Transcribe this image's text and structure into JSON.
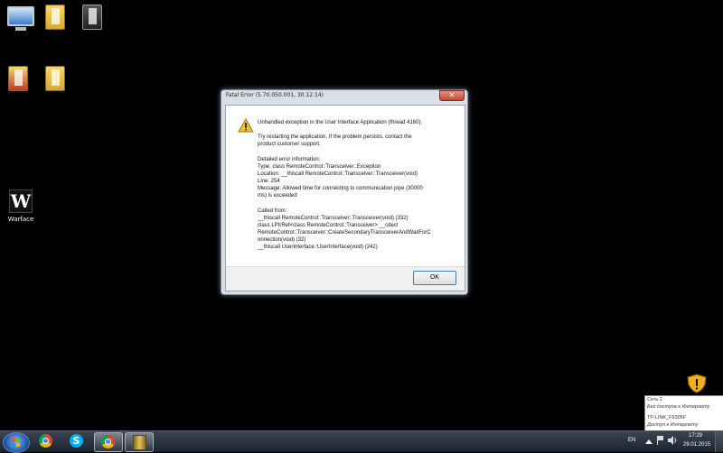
{
  "desktop": {
    "icons": [
      {
        "name": "computer-icon",
        "label": ""
      },
      {
        "name": "folder-icon",
        "label": ""
      },
      {
        "name": "folder-icon",
        "label": ""
      },
      {
        "name": "folder-icon",
        "label": ""
      },
      {
        "name": "folder-icon",
        "label": ""
      },
      {
        "name": "warface-icon",
        "label": "Warface"
      }
    ]
  },
  "dialog": {
    "title": "Fatal Error (5.70.050.001, 30.12.14)",
    "close_glyph": "✕",
    "lines": [
      "Unhandled exception in the User Interface Application (thread 4160).",
      "Try restarting the application. If the problem persists, contact the",
      "product customer support.",
      "Detailed error information:",
      "Type: class RemoteControl::Transceiver::Exception",
      "Location: __thiscall RemoteControl::Transceiver::Transceiver(void)",
      "Line: 254",
      "Message: Allowed time for connecting to communication pipe (30000",
      "ms) is exceeded",
      "Called from:",
      "__thiscall RemoteControl::Transceiver::Transceiver(void) (332)",
      "class LPtrRef<class RemoteControl::Transceiver> __cdecl",
      "RemoteControl::Transceiver::CreateSecondaryTransceiverAndWaitForC",
      "onnection(void) (32)",
      "__thiscall UserInterface::UserInterface(void) (242)"
    ],
    "ok_label": "OK",
    "warning_icon": "warning-icon"
  },
  "network_popup": {
    "line1": "Сеть 2",
    "line2": "Без доступа к Интернету",
    "line3": "TP-LINK_F9305F",
    "line4": "Доступ к Интернету"
  },
  "taskbar": {
    "pinned": [
      "chrome-icon",
      "skype-icon",
      "chrome-icon",
      "archive-icon"
    ],
    "language": "EN",
    "time": "17:29",
    "date": "29.01.2015",
    "skype_glyph": "S"
  },
  "colors": {
    "desktop_bg": "#000000",
    "close_button": "#c34a33",
    "ok_border": "#3c7fb1"
  }
}
